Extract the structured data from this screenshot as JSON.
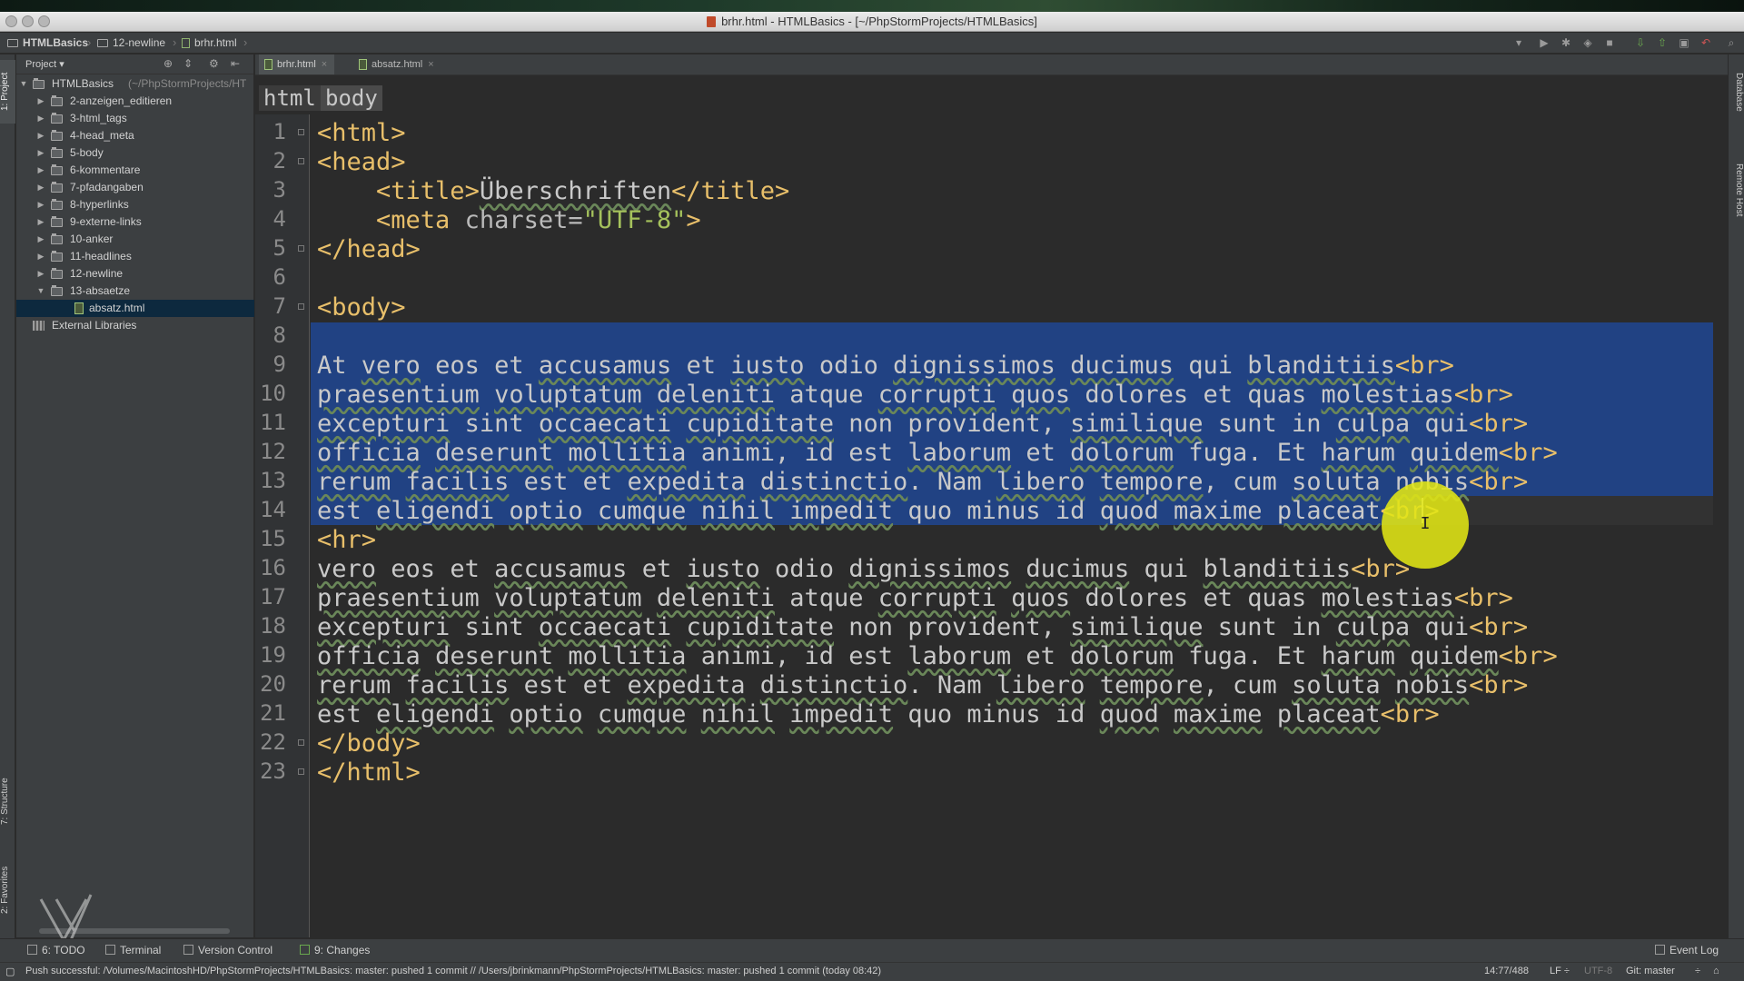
{
  "window": {
    "title": "brhr.html - HTMLBasics - [~/PhpStormProjects/HTMLBasics]"
  },
  "navbar": {
    "crumbs": [
      "HTMLBasics",
      "12-newline",
      "brhr.html"
    ]
  },
  "stripes": {
    "left_top": "1: Project",
    "left_structure": "7: Structure",
    "left_favorites": "2: Favorites",
    "right_database": "Database",
    "right_remote": "Remote Host"
  },
  "project": {
    "header": "Project",
    "root_name": "HTMLBasics",
    "root_hint": "(~/PhpStormProjects/HT",
    "folders": [
      "2-anzeigen_editieren",
      "3-html_tags",
      "4-head_meta",
      "5-body",
      "6-kommentare",
      "7-pfadangaben",
      "8-hyperlinks",
      "9-externe-links",
      "10-anker",
      "11-headlines",
      "12-newline",
      "13-absaetze"
    ],
    "selected_file": "absatz.html",
    "external": "External Libraries"
  },
  "tabs": [
    {
      "label": "brhr.html",
      "active": true
    },
    {
      "label": "absatz.html",
      "active": false
    }
  ],
  "tag_breadcrumbs": [
    "html",
    "body"
  ],
  "editor": {
    "line_numbers": [
      "1",
      "2",
      "3",
      "4",
      "5",
      "6",
      "7",
      "8",
      "9",
      "10",
      "11",
      "12",
      "13",
      "14",
      "15",
      "16",
      "17",
      "18",
      "19",
      "20",
      "21",
      "22",
      "23"
    ],
    "lines": [
      [
        {
          "t": "tag",
          "v": "<html>"
        }
      ],
      [
        {
          "t": "tag",
          "v": "<head>"
        }
      ],
      [
        {
          "t": "sp",
          "v": "    "
        },
        {
          "t": "tag",
          "v": "<title>"
        },
        {
          "t": "text",
          "v": "Überschriften"
        },
        {
          "t": "tag",
          "v": "</title>"
        }
      ],
      [
        {
          "t": "sp",
          "v": "    "
        },
        {
          "t": "tag",
          "v": "<meta "
        },
        {
          "t": "attr",
          "v": "charset="
        },
        {
          "t": "str",
          "v": "\"UTF-8\""
        },
        {
          "t": "tag",
          "v": ">"
        }
      ],
      [
        {
          "t": "tag",
          "v": "</head>"
        }
      ],
      [],
      [
        {
          "t": "tag",
          "v": "<body>"
        }
      ],
      [],
      [
        {
          "t": "text",
          "v": "At vero eos et accusamus et iusto odio dignissimos ducimus qui blanditiis"
        },
        {
          "t": "tag",
          "v": "<br>"
        }
      ],
      [
        {
          "t": "text",
          "v": "praesentium voluptatum deleniti atque corrupti quos dolores et quas molestias"
        },
        {
          "t": "tag",
          "v": "<br>"
        }
      ],
      [
        {
          "t": "text",
          "v": "excepturi sint occaecati cupiditate non provident, similique sunt in culpa qui"
        },
        {
          "t": "tag",
          "v": "<br>"
        }
      ],
      [
        {
          "t": "text",
          "v": "officia deserunt mollitia animi, id est laborum et dolorum fuga. Et harum quidem"
        },
        {
          "t": "tag",
          "v": "<br>"
        }
      ],
      [
        {
          "t": "text",
          "v": "rerum facilis est et expedita distinctio. Nam libero tempore, cum soluta nobis"
        },
        {
          "t": "tag",
          "v": "<br>"
        }
      ],
      [
        {
          "t": "text",
          "v": "est eligendi optio cumque nihil impedit quo minus id quod maxime placeat"
        },
        {
          "t": "tag",
          "v": "<br>"
        }
      ],
      [
        {
          "t": "tag",
          "v": "<hr>"
        }
      ],
      [
        {
          "t": "text",
          "v": "vero eos et accusamus et iusto odio dignissimos ducimus qui blanditiis"
        },
        {
          "t": "tag",
          "v": "<br>"
        }
      ],
      [
        {
          "t": "text",
          "v": "praesentium voluptatum deleniti atque corrupti quos dolores et quas molestias"
        },
        {
          "t": "tag",
          "v": "<br>"
        }
      ],
      [
        {
          "t": "text",
          "v": "excepturi sint occaecati cupiditate non provident, similique sunt in culpa qui"
        },
        {
          "t": "tag",
          "v": "<br>"
        }
      ],
      [
        {
          "t": "text",
          "v": "officia deserunt mollitia animi, id est laborum et dolorum fuga. Et harum quidem"
        },
        {
          "t": "tag",
          "v": "<br>"
        }
      ],
      [
        {
          "t": "text",
          "v": "rerum facilis est et expedita distinctio. Nam libero tempore, cum soluta nobis"
        },
        {
          "t": "tag",
          "v": "<br>"
        }
      ],
      [
        {
          "t": "text",
          "v": "est eligendi optio cumque nihil impedit quo minus id quod maxime placeat"
        },
        {
          "t": "tag",
          "v": "<br>"
        }
      ],
      [
        {
          "t": "tag",
          "v": "</body>"
        }
      ],
      [
        {
          "t": "tag",
          "v": "</html>"
        }
      ]
    ]
  },
  "bottom_tabs": [
    "6: TODO",
    "Terminal",
    "Version Control",
    "9: Changes"
  ],
  "event_log": "Event Log",
  "status": {
    "message": "Push successful: /Volumes/MacintoshHD/PhpStormProjects/HTMLBasics: master: pushed 1 commit // /Users/jbrinkmann/PhpStormProjects/HTMLBasics: master: pushed 1 commit (today 08:42)",
    "position": "14:77/488",
    "line_sep": "LF",
    "encoding": "UTF-8",
    "git": "Git: master"
  },
  "colors": {
    "tag": "#e8bf6a",
    "string": "#a5c25c",
    "selection": "#214283",
    "background": "#2b2b2b"
  },
  "icons": [
    "folder-icon",
    "html-file-icon",
    "library-icon",
    "close-icon",
    "play-icon",
    "debug-icon",
    "vcs-update-icon",
    "vcs-commit-icon",
    "undo-icon",
    "search-icon",
    "gear-icon"
  ]
}
